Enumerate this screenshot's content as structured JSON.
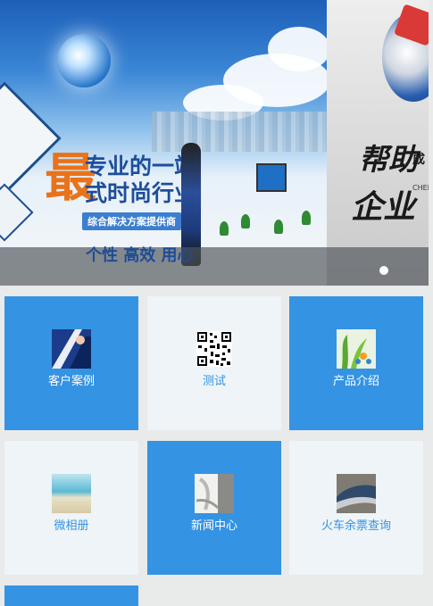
{
  "banner": {
    "slide1": {
      "headline_big": "最",
      "headline_line1": "专业的一站",
      "headline_line2": "式时尚行业",
      "tagline": "综合解决方案提供商",
      "footer_text": "个性  高效  用心"
    },
    "slide2": {
      "title_part1": "帮助",
      "title_part1_suffix": "成",
      "title_part2": "企业",
      "small_text": "CHEN"
    },
    "indicator_count": 1
  },
  "tiles": [
    {
      "label": "客户案例",
      "style": "blue",
      "icon": "customer-case-thumbnail"
    },
    {
      "label": "测试",
      "style": "light",
      "icon": "qr-code-thumbnail"
    },
    {
      "label": "产品介绍",
      "style": "blue",
      "icon": "product-plants-thumbnail"
    },
    {
      "label": "微相册",
      "style": "light",
      "icon": "beach-photo-thumbnail"
    },
    {
      "label": "新闻中心",
      "style": "blue",
      "icon": "news-thumbnail"
    },
    {
      "label": "火车余票查询",
      "style": "light",
      "icon": "train-thumbnail"
    },
    {
      "label": "",
      "style": "blue",
      "icon": ""
    }
  ],
  "colors": {
    "tile_blue": "#3593e3",
    "tile_light": "#eef4f7",
    "page_bg": "#e9eaea"
  }
}
